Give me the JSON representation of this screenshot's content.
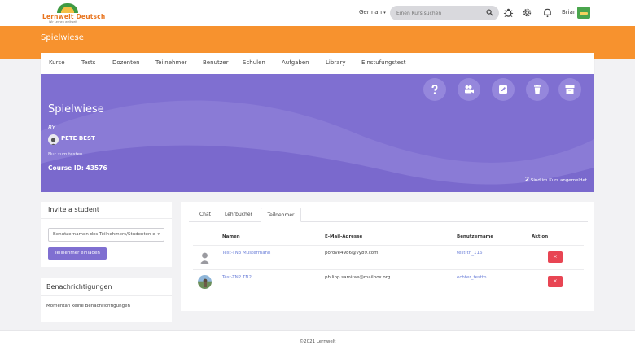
{
  "topbar": {
    "logo_text": "Lernwelt Deutsch",
    "logo_subtext": "Wir Lernen weltweit",
    "language": "German",
    "search_placeholder": "Einen Kurs suchen",
    "username": "Brian"
  },
  "page_title": "Spielwiese",
  "nav": {
    "items": [
      "Kurse",
      "Tests",
      "Dozenten",
      "Teilnehmer",
      "Benutzer",
      "Schulen",
      "Aufgaben",
      "Library",
      "Einstufungstest"
    ]
  },
  "hero": {
    "title": "Spielwiese",
    "by_label": "BY",
    "author": "PETE BEST",
    "description": "Nur zum testen",
    "course_id": "Course ID: 43576",
    "enrolled_count": "2",
    "enrolled_label": "Sind im Kurs angemeldet",
    "action_icons": [
      "help-icon",
      "video-camera-icon",
      "edit-icon",
      "trash-icon",
      "archive-icon"
    ]
  },
  "invite": {
    "title": "Invite a student",
    "select_placeholder": "Benutzernamen des Teilnehmers/Studenten eingeben",
    "button_label": "Teilnehmer einladen"
  },
  "notifications": {
    "title": "Benachrichtigungen",
    "empty_text": "Momentan keine Benachrichtigungen"
  },
  "main": {
    "tabs": [
      {
        "label": "Chat",
        "active": false
      },
      {
        "label": "Lehrbücher",
        "active": false
      },
      {
        "label": "Teilnehmer",
        "active": true
      }
    ],
    "table": {
      "headers": [
        "Namen",
        "E-Mail-Adresse",
        "Benutzername",
        "Aktion"
      ],
      "rows": [
        {
          "name": "Test-TN3 Mustermann",
          "email": "porove4986@vy89.com",
          "username": "test-tn_116",
          "action": "×"
        },
        {
          "name": "Test-TN2 TN2",
          "email": "philipp.samirae@mailbox.org",
          "username": "echter_testtn",
          "action": "×"
        }
      ]
    }
  },
  "footer": {
    "copyright": "©2021 Lernwelt"
  },
  "colors": {
    "orange": "#f7922e",
    "purple": "#7f6fd1",
    "danger": "#e84553",
    "link": "#6b7fd8"
  }
}
